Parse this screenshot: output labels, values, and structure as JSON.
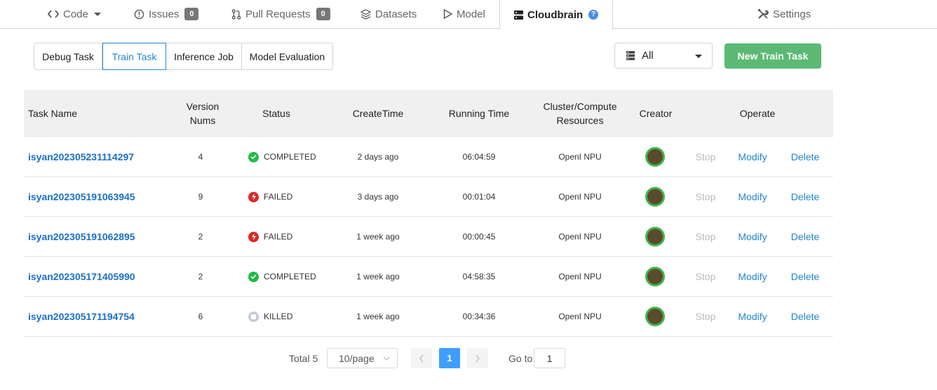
{
  "nav": {
    "tabs": [
      {
        "label": "Code",
        "icon": "code-icon"
      },
      {
        "label": "Issues",
        "icon": "issue-icon",
        "badge": "0"
      },
      {
        "label": "Pull Requests",
        "icon": "pull-request-icon",
        "badge": "0"
      },
      {
        "label": "Datasets",
        "icon": "datasets-icon"
      },
      {
        "label": "Model",
        "icon": "model-icon"
      },
      {
        "label": "Cloudbrain",
        "icon": "server-icon",
        "help": "?"
      },
      {
        "label": "Settings",
        "icon": "tools-icon"
      }
    ],
    "active": "Cloudbrain"
  },
  "task_tabs": {
    "items": [
      "Debug Task",
      "Train Task",
      "Inference Job",
      "Model Evaluation"
    ],
    "active": "Train Task"
  },
  "filter": {
    "value": "All",
    "icon": "cluster-icon"
  },
  "new_button": "New Train Task",
  "table": {
    "headers": {
      "name": "Task Name",
      "version_line1": "Version",
      "version_line2": "Nums",
      "status": "Status",
      "create": "CreateTime",
      "running": "Running Time",
      "cluster_line1": "Cluster/Compute",
      "cluster_line2": "Resources",
      "creator": "Creator",
      "operate": "Operate"
    },
    "rows": [
      {
        "name": "isyan202305231114297",
        "version": "4",
        "status": "COMPLETED",
        "status_kind": "completed",
        "create": "2 days ago",
        "running": "06:04:59",
        "cluster": "OpenI NPU",
        "stop": "Stop",
        "modify": "Modify",
        "delete": "Delete"
      },
      {
        "name": "isyan202305191063945",
        "version": "9",
        "status": "FAILED",
        "status_kind": "failed",
        "create": "3 days ago",
        "running": "00:01:04",
        "cluster": "OpenI NPU",
        "stop": "Stop",
        "modify": "Modify",
        "delete": "Delete"
      },
      {
        "name": "isyan202305191062895",
        "version": "2",
        "status": "FAILED",
        "status_kind": "failed",
        "create": "1 week ago",
        "running": "00:00:45",
        "cluster": "OpenI NPU",
        "stop": "Stop",
        "modify": "Modify",
        "delete": "Delete"
      },
      {
        "name": "isyan202305171405990",
        "version": "2",
        "status": "COMPLETED",
        "status_kind": "completed",
        "create": "1 week ago",
        "running": "04:58:35",
        "cluster": "OpenI NPU",
        "stop": "Stop",
        "modify": "Modify",
        "delete": "Delete"
      },
      {
        "name": "isyan202305171194754",
        "version": "6",
        "status": "KILLED",
        "status_kind": "killed",
        "create": "1 week ago",
        "running": "00:34:36",
        "cluster": "OpenI NPU",
        "stop": "Stop",
        "modify": "Modify",
        "delete": "Delete"
      }
    ]
  },
  "pagination": {
    "total": "Total 5",
    "page_size": "10/page",
    "current": "1",
    "goto_label": "Go to",
    "goto_value": "1"
  },
  "colors": {
    "accent": "#2185d0",
    "primary_green": "#5bb974",
    "completed": "#21ba45",
    "failed": "#db2828",
    "killed": "#c4cbd6",
    "pager_active": "#409eff"
  }
}
